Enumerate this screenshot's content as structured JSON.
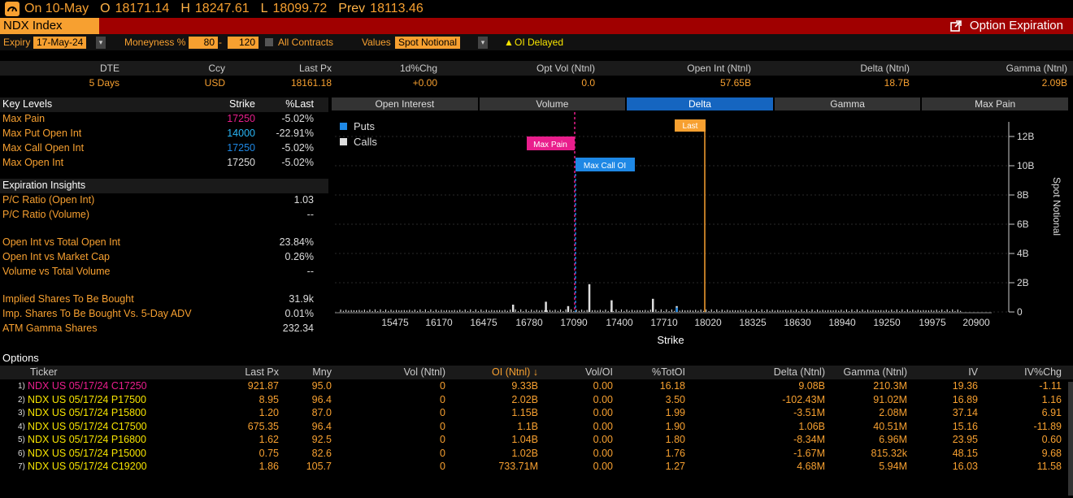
{
  "top": {
    "on": "On 10-May",
    "o_lbl": "O",
    "o": "18171.14",
    "h_lbl": "H",
    "h": "18247.61",
    "l_lbl": "L",
    "l": "18099.72",
    "prev_lbl": "Prev",
    "prev": "18113.46"
  },
  "title": {
    "security": "NDX Index",
    "function": "Option Expiration"
  },
  "controls": {
    "expiry_lbl": "Expiry",
    "expiry": "17-May-24",
    "moneyness_lbl": "Moneyness %",
    "m_low": "80",
    "m_high": "120",
    "all_contracts": "All Contracts",
    "values_lbl": "Values",
    "values": "Spot Notional",
    "oi_delayed": "OI Delayed"
  },
  "summary": {
    "headers": [
      "DTE",
      "Ccy",
      "Last Px",
      "1d%Chg",
      "Opt Vol (Ntnl)",
      "Open Int (Ntnl)",
      "Delta (Ntnl)",
      "Gamma (Ntnl)"
    ],
    "values": [
      "5 Days",
      "USD",
      "18161.18",
      "+0.00",
      "0.0",
      "57.65B",
      "18.7B",
      "2.09B"
    ]
  },
  "key_levels": {
    "header": {
      "name": "Key Levels",
      "strike": "Strike",
      "pct": "%Last"
    },
    "rows": [
      {
        "name": "Max Pain",
        "strike": "17250",
        "pct": "-5.02%",
        "color": "#e91e8c"
      },
      {
        "name": "Max Put Open Int",
        "strike": "14000",
        "pct": "-22.91%",
        "color": "#29b6f6"
      },
      {
        "name": "Max Call Open Int",
        "strike": "17250",
        "pct": "-5.02%",
        "color": "#1e88e5"
      },
      {
        "name": "Max Open Int",
        "strike": "17250",
        "pct": "-5.02%",
        "color": "#dddddd"
      }
    ]
  },
  "insights": {
    "header": "Expiration Insights",
    "rows": [
      {
        "name": "P/C Ratio (Open Int)",
        "val": "1.03"
      },
      {
        "name": "P/C Ratio (Volume)",
        "val": "--"
      },
      {
        "name": "Open Int vs Total Open Int",
        "val": "23.84%"
      },
      {
        "name": "Open Int vs Market Cap",
        "val": "0.26%"
      },
      {
        "name": "Volume vs Total Volume",
        "val": "--"
      },
      {
        "name": "Implied Shares To Be Bought",
        "val": "31.9k"
      },
      {
        "name": "Imp. Shares To Be Bought Vs. 5-Day ADV",
        "val": "0.01%"
      },
      {
        "name": "ATM Gamma Shares",
        "val": "232.34"
      }
    ]
  },
  "tabs": [
    "Open Interest",
    "Volume",
    "Delta",
    "Gamma",
    "Max Pain"
  ],
  "chart_data": {
    "type": "bar",
    "xlabel": "Strike",
    "ylabel": "Spot Notional",
    "x_ticks": [
      "15475",
      "16170",
      "16475",
      "16780",
      "17090",
      "17400",
      "17710",
      "18020",
      "18325",
      "18630",
      "18940",
      "19250",
      "19975",
      "20900"
    ],
    "y_ticks": [
      "0",
      "2B",
      "4B",
      "6B",
      "8B",
      "10B",
      "12B"
    ],
    "ylim": [
      0,
      13
    ],
    "legend": [
      "Puts",
      "Calls"
    ],
    "legend_colors": [
      "#1e88e5",
      "#dddddd"
    ],
    "markers": [
      {
        "label": "Max Pain",
        "strike": 17250,
        "color": "#e91e8c"
      },
      {
        "label": "Max Call OI",
        "strike": 17250,
        "color": "#1e88e5"
      },
      {
        "label": "Last",
        "strike": 18161.18,
        "color": "#f7a030"
      }
    ],
    "series": [
      {
        "name": "Calls",
        "x": [
          16780,
          17090,
          17300,
          17500,
          17710,
          18100,
          18325
        ],
        "values": [
          0.5,
          0.7,
          0.4,
          1.9,
          0.8,
          0.9,
          0.4
        ]
      },
      {
        "name": "Puts",
        "x": [
          18325
        ],
        "values": [
          0.3
        ]
      }
    ]
  },
  "options": {
    "title": "Options",
    "headers": [
      "Ticker",
      "Last Px",
      "Mny",
      "Vol (Ntnl)",
      "OI (Ntnl) ↓",
      "Vol/OI",
      "%TotOI",
      "Delta (Ntnl)",
      "Gamma (Ntnl)",
      "IV",
      "IV%Chg"
    ],
    "rows": [
      {
        "n": "1)",
        "t": "NDX US 05/17/24 C17250",
        "px": "921.87",
        "m": "95.0",
        "v": "0",
        "oi": "9.33B",
        "vo": "0.00",
        "tot": "16.18",
        "d": "9.08B",
        "g": "210.3M",
        "iv": "19.36",
        "ivc": "-1.11",
        "c": "#e91e8c"
      },
      {
        "n": "2)",
        "t": "NDX US 05/17/24 P17500",
        "px": "8.95",
        "m": "96.4",
        "v": "0",
        "oi": "2.02B",
        "vo": "0.00",
        "tot": "3.50",
        "d": "-102.43M",
        "g": "91.02M",
        "iv": "16.89",
        "ivc": "1.16",
        "c": "#f7e400"
      },
      {
        "n": "3)",
        "t": "NDX US 05/17/24 P15800",
        "px": "1.20",
        "m": "87.0",
        "v": "0",
        "oi": "1.15B",
        "vo": "0.00",
        "tot": "1.99",
        "d": "-3.51M",
        "g": "2.08M",
        "iv": "37.14",
        "ivc": "6.91",
        "c": "#f7e400"
      },
      {
        "n": "4)",
        "t": "NDX US 05/17/24 C17500",
        "px": "675.35",
        "m": "96.4",
        "v": "0",
        "oi": "1.1B",
        "vo": "0.00",
        "tot": "1.90",
        "d": "1.06B",
        "g": "40.51M",
        "iv": "15.16",
        "ivc": "-11.89",
        "c": "#f7e400"
      },
      {
        "n": "5)",
        "t": "NDX US 05/17/24 P16800",
        "px": "1.62",
        "m": "92.5",
        "v": "0",
        "oi": "1.04B",
        "vo": "0.00",
        "tot": "1.80",
        "d": "-8.34M",
        "g": "6.96M",
        "iv": "23.95",
        "ivc": "0.60",
        "c": "#f7e400"
      },
      {
        "n": "6)",
        "t": "NDX US 05/17/24 P15000",
        "px": "0.75",
        "m": "82.6",
        "v": "0",
        "oi": "1.02B",
        "vo": "0.00",
        "tot": "1.76",
        "d": "-1.67M",
        "g": "815.32k",
        "iv": "48.15",
        "ivc": "9.68",
        "c": "#f7e400"
      },
      {
        "n": "7)",
        "t": "NDX US 05/17/24 C19200",
        "px": "1.86",
        "m": "105.7",
        "v": "0",
        "oi": "733.71M",
        "vo": "0.00",
        "tot": "1.27",
        "d": "4.68M",
        "g": "5.94M",
        "iv": "16.03",
        "ivc": "11.58",
        "c": "#f7e400"
      }
    ]
  }
}
